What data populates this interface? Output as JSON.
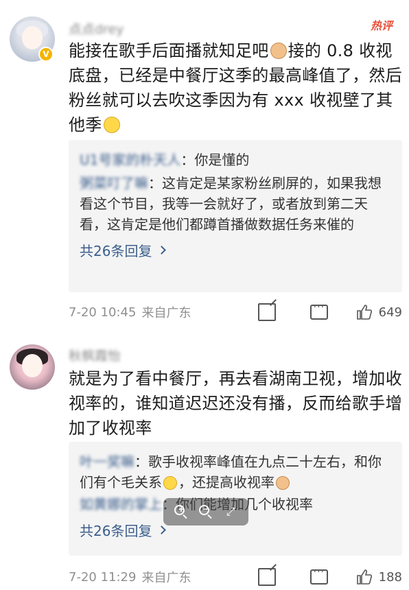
{
  "comments": [
    {
      "username": "点点drey",
      "hot_tag": "热评",
      "text_part1": "能接在歌手后面播就知足吧",
      "text_part2": "接的 0.8 收视底盘，已经是中餐厅这季的最高峰值了，然后粉丝就可以去吹这季因为有 xxx 收视壁了其他季",
      "reply1_author": "U1号家的朴天人",
      "reply1_text": "：你是懂的",
      "reply2_author": "粥菜叮了嘛",
      "reply2_text": "：这肯定是某家粉丝刷屏的，如果我想看这个节目，我等一会就好了，或者放到第二天看，这肯定是他们都蹲首播做数据任务来催的",
      "more_replies": "共26条回复",
      "time": "7-20 10:45",
      "location": "来自广东",
      "likes": "649"
    },
    {
      "username": "秋枫霞怡",
      "text_part1": "就是为了看中餐厅，再去看湖南卫视，增加收视率的，谁知道迟迟还没有播，反而给歌手增加了收视率",
      "reply1_author": "叶一奖嘛",
      "reply1_text": "：歌手收视率峰值在九点二十左右，和你们有个毛关系",
      "reply1_tail": "，还提高收视率",
      "reply2_author": "如黄娜的掌上",
      "reply2_text": "：你们能增加几个收视率",
      "more_replies": "共26条回复",
      "time": "7-20 11:29",
      "location": "来自广东",
      "likes": "188"
    }
  ],
  "icons": [
    "verified-badge-icon",
    "share-icon",
    "comment-icon",
    "like-icon",
    "zoom-in-icon",
    "zoom-out-icon",
    "expand-icon"
  ]
}
